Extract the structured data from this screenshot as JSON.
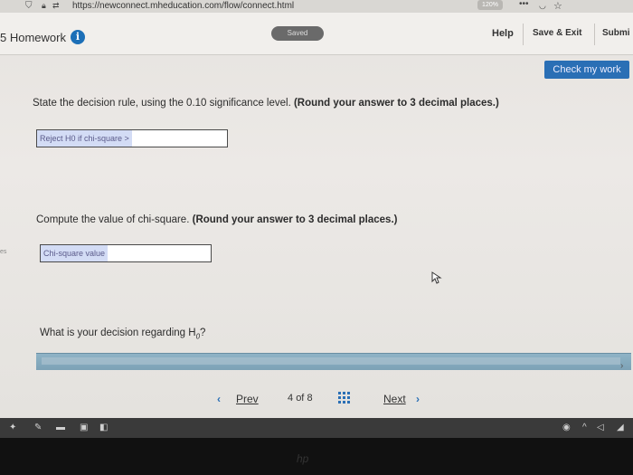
{
  "browser": {
    "url": "https://newconnect.mheducation.com/flow/connect.html",
    "zoom": "120%"
  },
  "header": {
    "title": "5 Homework",
    "saved": "Saved",
    "help": "Help",
    "save_exit": "Save & Exit",
    "submit": "Submi"
  },
  "check_my_work": "Check my work",
  "q1": {
    "prompt": "State the decision rule, using the 0.10 significance level.",
    "round": "(Round your answer to 3 decimal places.)",
    "field_label": "Reject H0 if chi-square >",
    "value": ""
  },
  "q2": {
    "prompt": "Compute the value of chi-square.",
    "round": "(Round your answer to 3 decimal places.)",
    "field_label": "Chi-square value",
    "value": ""
  },
  "q3": {
    "prompt": "What is your decision regarding H",
    "sub": "0",
    "end": "?"
  },
  "left_tab": "es",
  "pager": {
    "prev": "Prev",
    "current": "4",
    "of": "of",
    "total": "8",
    "next": "Next"
  },
  "icons": [
    "shield-icon",
    "lock-icon",
    "info-icon",
    "grid-icon",
    "chevron-left-icon",
    "chevron-right-icon"
  ]
}
